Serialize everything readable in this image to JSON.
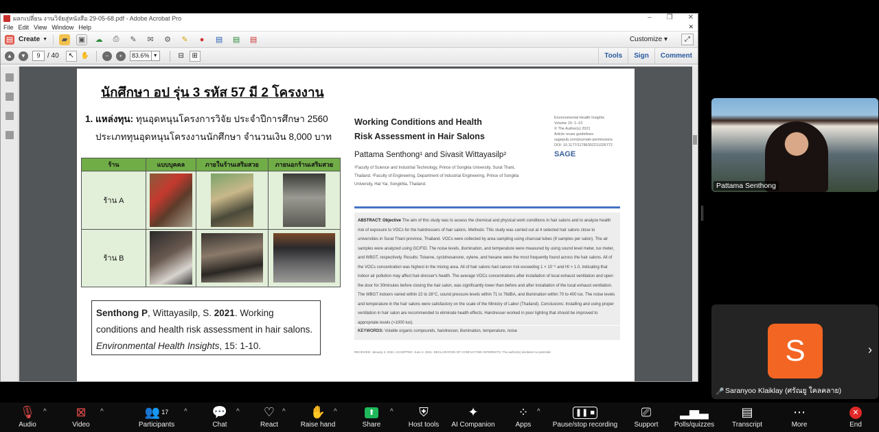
{
  "acrobat": {
    "window_title": "ผลกเปลี่ยน งานวิจัยสู่หนังสือ 29-05-68.pdf - Adobe Acrobat Pro",
    "menu": [
      "File",
      "Edit",
      "View",
      "Window",
      "Help"
    ],
    "create_label": "Create",
    "customize_label": "Customize",
    "current_page": "9",
    "page_total": "/ 40",
    "zoom": "83.6%",
    "right_tabs": [
      "Tools",
      "Sign",
      "Comment"
    ]
  },
  "slide": {
    "title": "นักศึกษา อป รุ่น 3 รหัส 57 มี 2 โครงงาน",
    "fund_label": "1. แหล่งทุน:",
    "fund_line1": " ทุนอุดหนุนโครงการวิจัย ประจำปีการศึกษา 2560",
    "fund_line2": "ประเภททุนอุดหนุนโครงงานนักศึกษา จำนวนเงิน 8,000 บาท",
    "table_headers": [
      "ร้าน",
      "แบบบุคคล",
      "ภายในร้านเสริมสวย",
      "ภายนอกร้านเสริมสวย"
    ],
    "rows": [
      "ร้าน A",
      "ร้าน B"
    ],
    "citation_authors": "Senthong P",
    "citation_authors2": ", Wittayasilp, S. ",
    "citation_year": "2021",
    "citation_rest": ". Working conditions and health risk assessment in hair salons.",
    "citation_journal": "Environmental Health Insights",
    "citation_pages": ", 15: 1-10."
  },
  "article": {
    "title": "Working Conditions and Health Risk Assessment in Hair Salons",
    "journal_lines": [
      "Environmental Health Insights",
      "Volume 15: 1–10",
      "© The Author(s) 2021",
      "Article reuse guidelines:",
      "sagepub.com/journals-permissions",
      "DOI: 10.1177/11786302211026772"
    ],
    "publisher": "SAGE",
    "authors": "Pattama Senthong¹ and Sivasit Wittayasilp²",
    "affiliations": "¹Faculty of Science and Industrial Technology, Prince of Songkla University, Surat Thani, Thailand. ²Faculty of Engineering, Department of Industrial Engineering, Prince of Songkla University, Hat Yai, Songkhla, Thailand.",
    "abstract_label": "ABSTRACT: Objective",
    "abstract_text": " The aim of this study was to assess the chemical and physical work conditions in hair salons and to analyze health risk of exposure to VOCs for the hairdressers of hair salons. Methods: This study was carried out at 4 selected hair salons close to universities in Surat Thani province, Thailand. VOCs were collected by area sampling using charcoal tubes (9 samples per salon). The air samples were analyzed using GC/FID. The noise levels, illumination, and temperature were measured by using sound level meter, lux meter, and WBGT, respectively. Results: Toluene, cyclohexanone, xylene, and hexane were the most frequently found across the hair salons. All of the VOCs concentration was highest in the mixing area. All of hair salons had cancer risk exceeding 1 × 10⁻⁶ and HI > 1.0, indicating that indoor air pollution may affect hair-dresser's health. The average VOCs concentrations after installation of local exhaust ventilation and open the door for 30minutes before closing the hair salon, was significantly lower than before and after installation of the local exhaust ventilation. The WBGT indoors varied within 22 to 28°C, sound pressure levels within 71 to 76dBA, and illumination within 70 to 400 lux. The noise levels and temperature in the hair salons were satisfactory on the scale of the Ministry of Labor (Thailand). Conclusions: Installing and using proper ventilation in hair salon are recommended to eliminate health effects. Hairdresser worked in poor lighting that should be improved to appropriate levels (>1000 lux).",
    "keywords_label": "KEYWORDS:",
    "keywords": " Volatile organic compounds, hairdresser, illumination, temperature, noise",
    "received": "RECEIVED: January 4, 2021. ACCEPTED: June 2, 2021.          DECLARATION OF CONFLICTING INTERESTS: The author(s) declared no potential"
  },
  "participants": {
    "presenter_name": "Pattama Senthong",
    "avatar_initial": "S",
    "avatar_name": "Saranyoo Klaiklay (ศรัณยู ใคลคลาย)"
  },
  "controls": {
    "audio": "Audio",
    "video": "Video",
    "participants": "Participants",
    "participants_count": "17",
    "chat": "Chat",
    "react": "React",
    "raise_hand": "Raise hand",
    "share": "Share",
    "host_tools": "Host tools",
    "ai_companion": "AI Companion",
    "apps": "Apps",
    "pause_recording": "Pause/stop recording",
    "support": "Support",
    "polls": "Polls/quizzes",
    "transcript": "Transcript",
    "more": "More",
    "end": "End"
  },
  "colors": {
    "zoom_bar": "#0d0d0d",
    "avatar": "#f26522",
    "table_header": "#70ad47",
    "article_rule": "#4472c4",
    "share_green": "#1fb85a",
    "end_red": "#e02828"
  }
}
